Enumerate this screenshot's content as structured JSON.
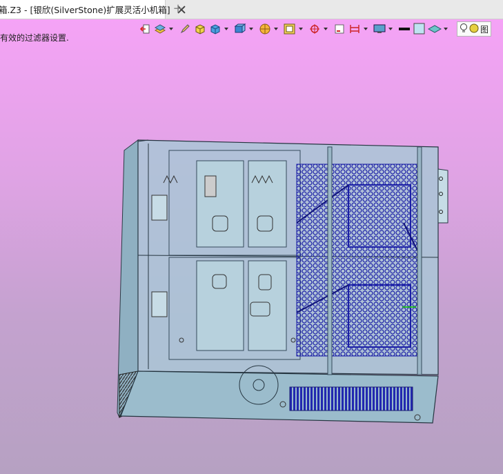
{
  "tab": {
    "title": "箱.Z3 - [银欣(SilverStone)扩展灵活小机箱]"
  },
  "status_text": "有效的过滤器设置.",
  "toolbar_icons": [
    "exit-icon",
    "layers-icon",
    "pencil-icon",
    "cube-yellow-icon",
    "cube-blue-icon",
    "cube-view-icon",
    "render-mode-icon",
    "frame-icon",
    "crosshair-icon",
    "sheet-icon",
    "dimension-icon",
    "display-icon",
    "line-style-icon",
    "color-swatch-icon",
    "plane-icon",
    "lightbulb-icon",
    "light-sphere-icon"
  ],
  "light_label": "图",
  "colors": {
    "bg_top": "#f5a3f6",
    "bg_bottom": "#b6a1c2",
    "case_fill": "#a9c7d6",
    "mesh": "#1b1fa6"
  }
}
